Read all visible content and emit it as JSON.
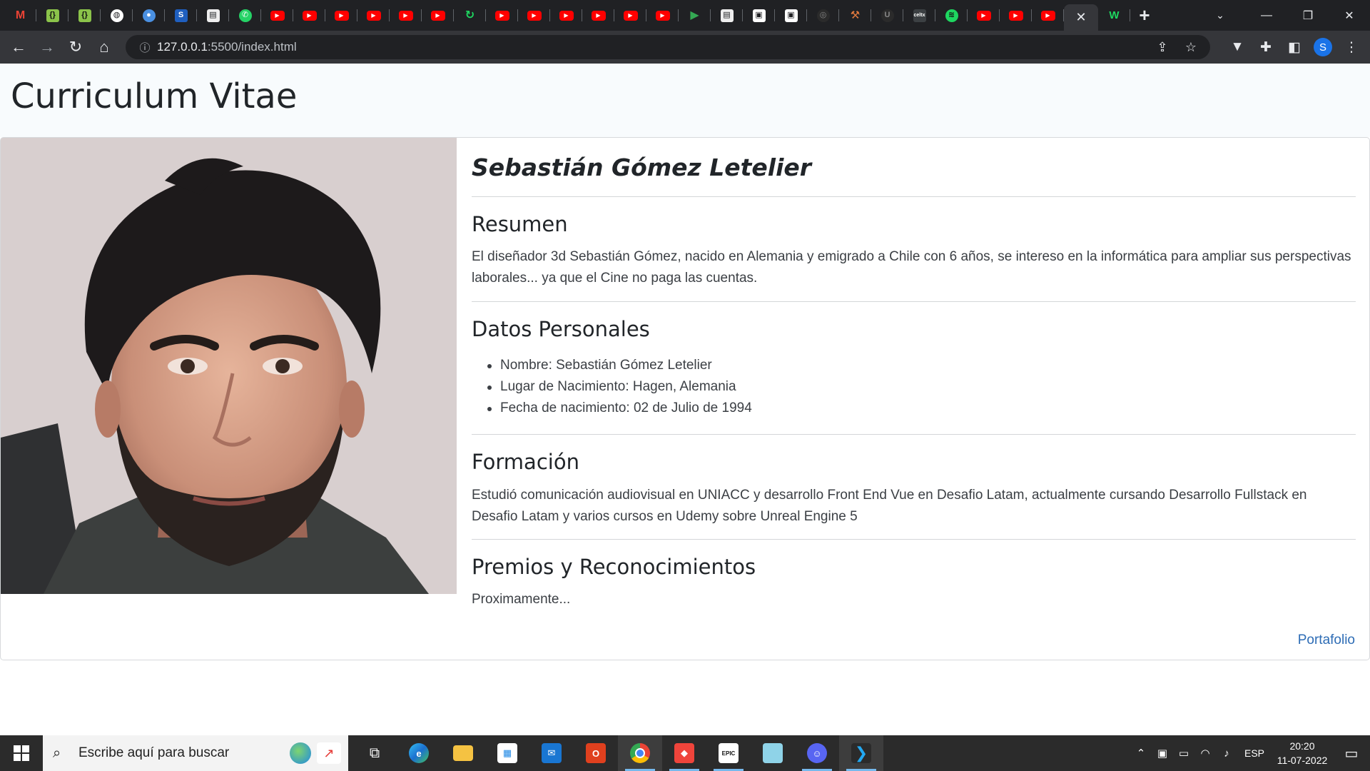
{
  "browser": {
    "url_host": "127.0.0.1",
    "url_rest": ":5500/index.html",
    "active_tab_close": "✕",
    "new_tab": "+",
    "profile_initial": "S"
  },
  "page": {
    "title": "Curriculum Vitae",
    "name": "Sebastián Gómez Letelier",
    "sections": {
      "summary_title": "Resumen",
      "summary_text": "El diseñador 3d Sebastián Gómez, nacido en Alemania y emigrado a Chile con 6 años, se intereso en la informática para ampliar sus perspectivas laborales... ya que el Cine no paga las cuentas.",
      "personal_title": "Datos Personales",
      "personal_items": [
        "Nombre: Sebastián Gómez Letelier",
        "Lugar de Nacimiento: Hagen, Alemania",
        "Fecha de nacimiento: 02 de Julio de 1994"
      ],
      "education_title": "Formación",
      "education_text": "Estudió comunicación audiovisual en UNIACC y desarrollo Front End Vue en Desafio Latam, actualmente cursando Desarrollo Fullstack en Desafio Latam y varios cursos en Udemy sobre Unreal Engine 5",
      "awards_title": "Premios y Reconocimientos",
      "awards_text": "Proximamente..."
    },
    "portfolio_link": "Portafolio"
  },
  "taskbar": {
    "search_placeholder": "Escribe aquí para buscar",
    "language": "ESP",
    "time": "20:20",
    "date": "11-07-2022"
  },
  "colors": {
    "accent_link": "#2d6cb5",
    "page_header_bg": "#f8fbfd",
    "chrome_dark": "#202124"
  }
}
